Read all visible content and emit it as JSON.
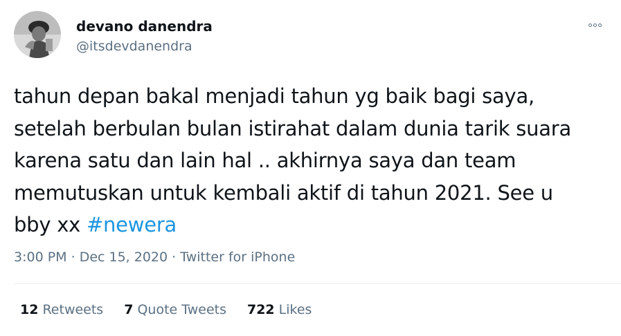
{
  "user": {
    "name": "devano danendra",
    "handle": "@itsdevdanendra"
  },
  "tweet": {
    "lines": [
      "tahun depan bakal menjadi tahun yg baik bagi saya,",
      "setelah berbulan bulan istirahat dalam dunia tarik suara",
      "karena satu dan lain hal .. akhirnya saya dan team",
      "memutuskan untuk kembali aktif di tahun 2021. See u"
    ],
    "last_line_text": "bby xx ",
    "hashtag": "#newera"
  },
  "meta": {
    "time": "3:00 PM",
    "separator": " · ",
    "date": "Dec 15, 2020",
    "source": "Twitter for iPhone"
  },
  "stats": {
    "retweets_count": "12",
    "retweets_label": "Retweets",
    "quote_count": "7",
    "quote_label": "Quote Tweets",
    "likes_count": "722",
    "likes_label": "Likes"
  },
  "icons": {
    "more": "more-options-icon"
  }
}
